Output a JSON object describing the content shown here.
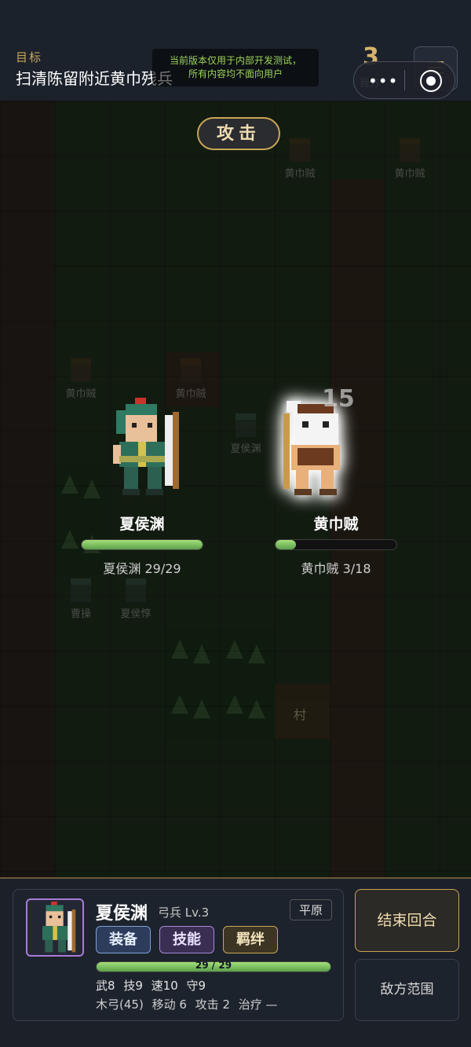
{
  "header": {
    "goal_label": "目标",
    "goal_text": "扫清陈留附近黄巾残兵",
    "notice_line1": "当前版本仅用于内部开发测试，",
    "notice_line2": "所有内容均不面向用户",
    "turn_number": "3",
    "turn_side": "我方",
    "capsule_dots": "•••"
  },
  "map": {
    "attack_label": "攻击",
    "ghost_units": [
      {
        "label": "黄巾贼",
        "side": "enemy"
      },
      {
        "label": "黄巾贼",
        "side": "enemy"
      },
      {
        "label": "黄巾贼",
        "side": "enemy"
      },
      {
        "label": "黄巾贼",
        "side": "enemy"
      },
      {
        "label": "夏侯渊",
        "side": "ally"
      },
      {
        "label": "曹操",
        "side": "ally"
      },
      {
        "label": "夏侯惇",
        "side": "ally"
      }
    ],
    "village_label": "村",
    "damage_number": "15"
  },
  "battle": {
    "attacker": {
      "name": "夏侯渊",
      "hp_text": "夏侯渊 29/29",
      "hp": 29,
      "hp_max": 29
    },
    "defender": {
      "name": "黄巾贼",
      "hp_text": "黄巾贼 3/18",
      "hp": 3,
      "hp_max": 18
    }
  },
  "unit_panel": {
    "name": "夏侯渊",
    "class_level": "弓兵 Lv.3",
    "terrain": "平原",
    "buttons": {
      "equip": "装备",
      "skill": "技能",
      "bond": "羁绊"
    },
    "hp_text": "29 / 29",
    "hp": 29,
    "hp_max": 29,
    "stats": {
      "wu": "武8",
      "ji": "技9",
      "su": "速10",
      "shou": "守9"
    },
    "info": {
      "weapon": "木弓(45)",
      "move": "移动 6",
      "attack": "攻击 2",
      "heal": "治疗 —"
    }
  },
  "side_buttons": {
    "end_turn": "结束回合",
    "enemy_range": "敌方范围"
  },
  "colors": {
    "gold": "#c9a557",
    "hp_green": "#8ed068",
    "skill_purple": "#a988d8",
    "equip_blue": "#7da0d8"
  }
}
